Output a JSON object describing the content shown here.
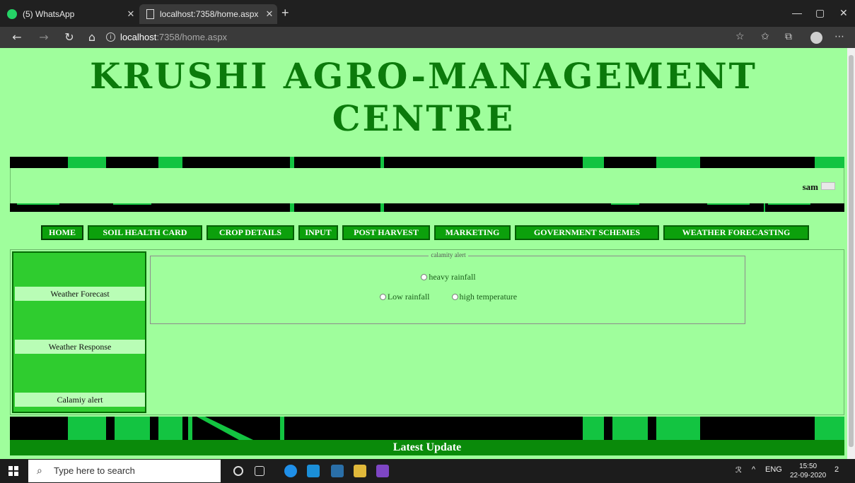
{
  "browser": {
    "tabs": [
      {
        "title": "(5) WhatsApp"
      },
      {
        "title": "localhost:7358/home.aspx"
      }
    ],
    "new_tab": "+",
    "url_host": "localhost",
    "url_rest": ":7358/home.aspx"
  },
  "site": {
    "title_line1": "KRUSHI AGRO-MANAGEMENT",
    "title_line2": "CENTRE",
    "username": "sam"
  },
  "menu": {
    "items": [
      {
        "label": "HOME"
      },
      {
        "label": "SOIL HEALTH CARD"
      },
      {
        "label": "CROP DETAILS"
      },
      {
        "label": "INPUT"
      },
      {
        "label": "POST HARVEST"
      },
      {
        "label": "MARKETING"
      },
      {
        "label": "GOVERNMENT SCHEMES"
      },
      {
        "label": "WEATHER FORECASTING"
      }
    ]
  },
  "sidebar": {
    "links": [
      {
        "label": "Weather Forecast"
      },
      {
        "label": "Weather Response"
      },
      {
        "label": "Calamiy alert"
      }
    ]
  },
  "calamity": {
    "legend": "calamity alert",
    "options": [
      "heavy rainfall",
      "Low rainfall",
      "high temperature"
    ]
  },
  "footer": {
    "latest_update": "Latest Update"
  },
  "taskbar": {
    "search_placeholder": "Type here to search",
    "language": "ENG",
    "time": "15:50",
    "date": "22-09-2020",
    "notification_count": "2"
  },
  "colors": {
    "page_bg": "#9ffe9c",
    "title_green": "#0b7a0b",
    "menu_green": "#0ca00c",
    "stripe_green": "#13c441"
  }
}
